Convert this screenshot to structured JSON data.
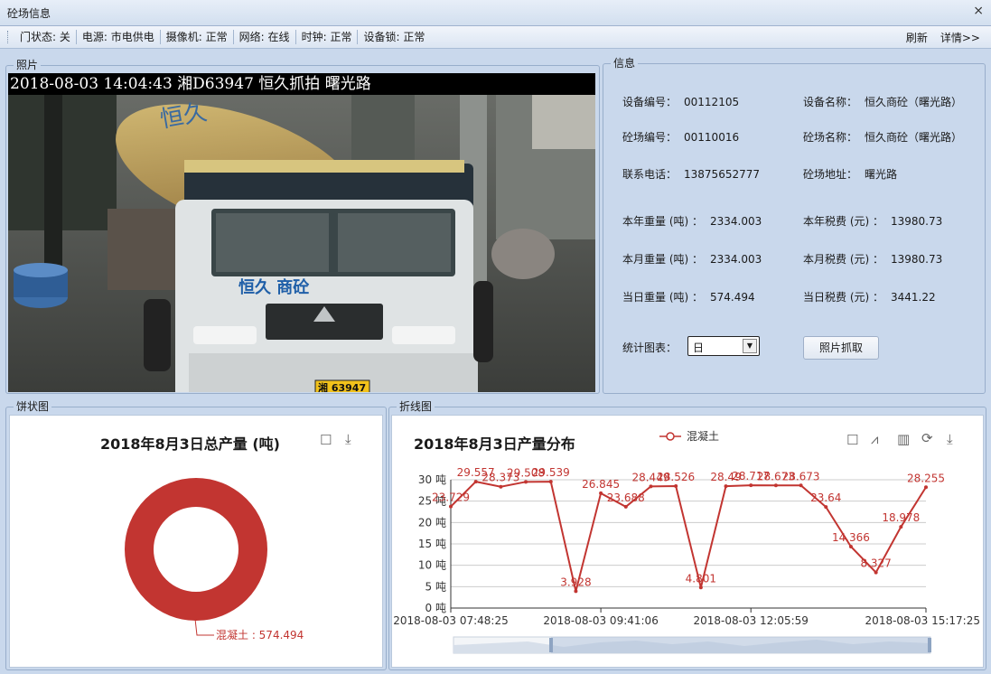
{
  "window": {
    "title": "砼场信息",
    "close_label": "⨯"
  },
  "status": {
    "items": [
      {
        "label": "门状态:",
        "value": "关"
      },
      {
        "label": "电源:",
        "value": "市电供电"
      },
      {
        "label": "摄像机:",
        "value": "正常"
      },
      {
        "label": "网络:",
        "value": "在线"
      },
      {
        "label": "时钟:",
        "value": "正常"
      },
      {
        "label": "设备锁:",
        "value": "正常"
      }
    ],
    "refresh": "刷新",
    "details": "详情>>"
  },
  "photo": {
    "legend": "照片",
    "caption": "2018-08-03 14:04:43 湘D63947 恒久抓拍 曙光路",
    "truck_brand": "恒久 商砼",
    "plate": "湘 63947"
  },
  "info": {
    "legend": "信息",
    "device_no_label": "设备编号：",
    "device_no": "00112105",
    "device_name_label": "设备名称：",
    "device_name": "恒久商砼（曙光路）",
    "site_no_label": "砼场编号：",
    "site_no": "00110016",
    "site_name_label": "砼场名称：",
    "site_name": "恒久商砼（曙光路）",
    "phone_label": "联系电话：",
    "phone": "13875652777",
    "address_label": "砼场地址：",
    "address": "曙光路",
    "year_weight_label": "本年重量 (吨) ：",
    "year_weight": "2334.003",
    "year_tax_label": "本年税费 (元) ：",
    "year_tax": "13980.73",
    "month_weight_label": "本月重量 (吨) ：",
    "month_weight": "2334.003",
    "month_tax_label": "本月税费 (元) ：",
    "month_tax": "13980.73",
    "day_weight_label": "当日重量 (吨) ：",
    "day_weight": "574.494",
    "day_tax_label": "当日税费 (元) ：",
    "day_tax": "3441.22",
    "stat_chart_label": "统计图表：",
    "stat_chart_value": "日",
    "capture_button": "照片抓取"
  },
  "pie": {
    "legend": "饼状图",
    "title": "2018年8月3日总产量 (吨)",
    "slice_label": "混凝土 : 574.494",
    "color": "#c23531"
  },
  "line": {
    "legend": "折线图",
    "title": "2018年8月3日产量分布",
    "series_legend": "混凝土",
    "color": "#c23531"
  },
  "chart_data": [
    {
      "type": "pie",
      "title": "2018年8月3日总产量 (吨)",
      "slices": [
        {
          "name": "混凝土",
          "value": 574.494
        }
      ]
    },
    {
      "type": "line",
      "title": "2018年8月3日产量分布",
      "series": [
        {
          "name": "混凝土",
          "values": [
            23.729,
            29.557,
            28.373,
            29.508,
            29.539,
            3.928,
            26.845,
            23.688,
            28.449,
            28.526,
            4.801,
            28.49,
            28.717,
            28.673,
            28.673,
            23.64,
            14.366,
            8.327,
            18.978,
            28.255
          ]
        }
      ],
      "x_ticks": [
        "2018-08-03 07:48:25",
        "2018-08-03 09:41:06",
        "2018-08-03 12:05:59",
        "2018-08-03 15:17:25"
      ],
      "y_ticks": [
        "0 吨",
        "5 吨",
        "10 吨",
        "15 吨",
        "20 吨",
        "25 吨",
        "30 吨"
      ],
      "ylim": [
        0,
        30
      ],
      "legend_position": "top-center",
      "data_zoom": true
    }
  ]
}
